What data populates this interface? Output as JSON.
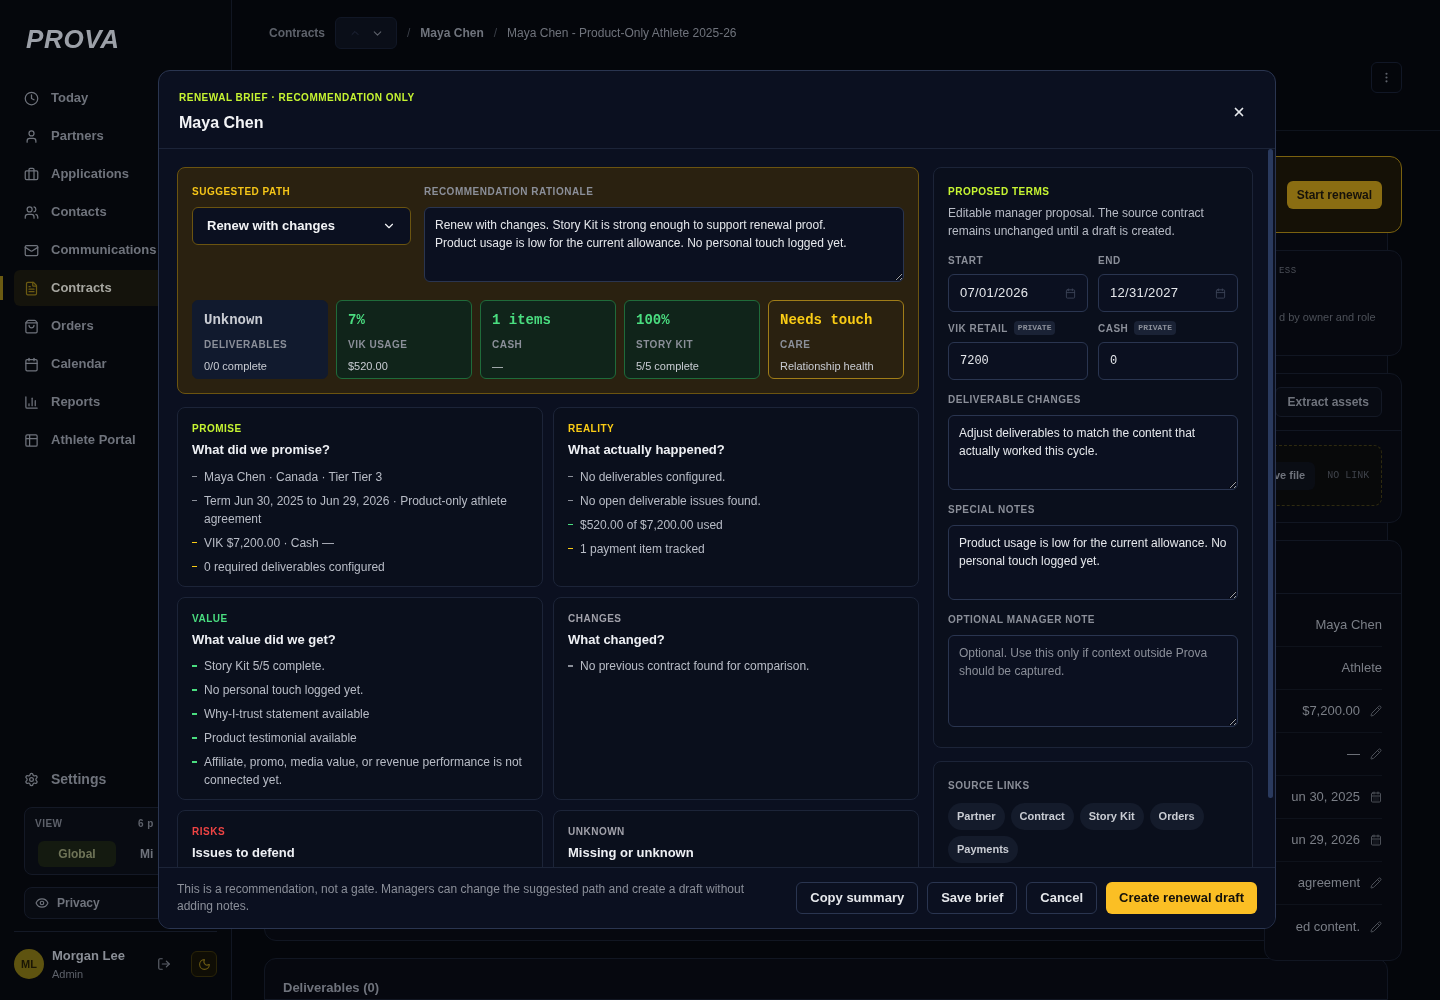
{
  "sidebar": {
    "logo": "PROVA",
    "nav": [
      {
        "label": "Today",
        "selected": false
      },
      {
        "label": "Partners",
        "selected": false
      },
      {
        "label": "Applications",
        "selected": false
      },
      {
        "label": "Contacts",
        "selected": false
      },
      {
        "label": "Communications",
        "selected": false
      },
      {
        "label": "Contracts",
        "selected": true
      },
      {
        "label": "Orders",
        "selected": false
      },
      {
        "label": "Calendar",
        "selected": false
      },
      {
        "label": "Reports",
        "selected": false
      },
      {
        "label": "Athlete Portal",
        "selected": false
      }
    ],
    "settings": "Settings",
    "view": {
      "label": "VIEW",
      "count": "6 p",
      "options": [
        {
          "label": "Global",
          "selected": true
        },
        {
          "label": "Mi",
          "selected": false
        }
      ]
    },
    "privacy": "Privacy",
    "user": {
      "initials": "ML",
      "name": "Morgan Lee",
      "role": "Admin"
    }
  },
  "header": {
    "breadcrumb": [
      {
        "label": "Contracts",
        "kind": "link"
      },
      {
        "label": "/",
        "kind": "separator"
      },
      {
        "label": "Maya Chen",
        "kind": "link"
      },
      {
        "label": "/",
        "kind": "separator"
      },
      {
        "label": "Maya Chen - Product-Only Athlete 2025-26",
        "kind": "current"
      }
    ]
  },
  "side_panel": {
    "start_button": "Start renewal",
    "access_label": "ESS",
    "access_text": "d by owner and role",
    "extract_button": "Extract assets",
    "file_button": "ve file",
    "link_status": "NO LINK",
    "rows": [
      {
        "value": "Maya Chen",
        "kind": "plain"
      },
      {
        "value": "Athlete",
        "kind": "plain"
      },
      {
        "value": "$7,200.00",
        "kind": "editable"
      },
      {
        "value": "—",
        "kind": "editable"
      },
      {
        "value": "un 30, 2025",
        "kind": "date"
      },
      {
        "value": "un 29, 2026",
        "kind": "date"
      },
      {
        "value": "agreement",
        "kind": "editable"
      },
      {
        "value": "ed content.",
        "kind": "editable"
      }
    ]
  },
  "deliverables_title": "Deliverables (0)",
  "modal": {
    "eyebrow": "RENEWAL BRIEF · RECOMMENDATION ONLY",
    "title": "Maya Chen",
    "suggested_path": {
      "label": "SUGGESTED PATH",
      "value": "Renew with changes"
    },
    "rationale": {
      "label": "RECOMMENDATION RATIONALE",
      "value": "Renew with changes. Story Kit is strong enough to support renewal proof.\nProduct usage is low for the current allowance. No personal touch logged yet."
    },
    "metrics": [
      {
        "value": "Unknown",
        "label": "DELIVERABLES",
        "detail": "0/0 complete",
        "kind": "neutral"
      },
      {
        "value": "7%",
        "label": "VIK USAGE",
        "detail": "$520.00",
        "kind": "good"
      },
      {
        "value": "1 items",
        "label": "CASH",
        "detail": "—",
        "kind": "good"
      },
      {
        "value": "100%",
        "label": "STORY KIT",
        "detail": "5/5 complete",
        "kind": "good"
      },
      {
        "value": "Needs touch",
        "label": "CARE",
        "detail": "Relationship health",
        "kind": "warn"
      }
    ],
    "sections": [
      {
        "eyebrow": "PROMISE",
        "color": "#c6f432",
        "title": "What did we promise?",
        "items": [
          {
            "text": "Maya Chen · Canada · Tier Tier 3",
            "color": "#8b8f99"
          },
          {
            "text": "Term Jun 30, 2025 to Jun 29, 2026 · Product-only athlete agreement",
            "color": "#8b8f99"
          },
          {
            "text": "VIK $7,200.00 · Cash —",
            "color": "#facc15"
          },
          {
            "text": "0 required deliverables configured",
            "color": "#facc15"
          }
        ]
      },
      {
        "eyebrow": "REALITY",
        "color": "#facc15",
        "title": "What actually happened?",
        "items": [
          {
            "text": "No deliverables configured.",
            "color": "#8b8f99"
          },
          {
            "text": "No open deliverable issues found.",
            "color": "#8b8f99"
          },
          {
            "text": "$520.00 of $7,200.00 used",
            "color": "#4ade80"
          },
          {
            "text": "1 payment item tracked",
            "color": "#facc15"
          }
        ]
      },
      {
        "eyebrow": "VALUE",
        "color": "#4ade80",
        "title": "What value did we get?",
        "items": [
          {
            "text": "Story Kit 5/5 complete.",
            "color": "#4ade80"
          },
          {
            "text": "No personal touch logged yet.",
            "color": "#4ade80"
          },
          {
            "text": "Why-I-trust statement available",
            "color": "#4ade80"
          },
          {
            "text": "Product testimonial available",
            "color": "#4ade80"
          },
          {
            "text": "Affiliate, promo, media value, or revenue performance is not connected yet.",
            "color": "#4ade80"
          }
        ]
      },
      {
        "eyebrow": "CHANGES",
        "color": "#a1a1aa",
        "title": "What changed?",
        "items": [
          {
            "text": "No previous contract found for comparison.",
            "color": "#8b8f99"
          }
        ]
      },
      {
        "eyebrow": "RISKS",
        "color": "#ef4444",
        "title": "Issues to defend"
      },
      {
        "eyebrow": "UNKNOWN",
        "color": "#a1a1aa",
        "title": "Missing or unknown"
      }
    ],
    "terms": {
      "label": "PROPOSED TERMS",
      "description": "Editable manager proposal. The source contract remains unchanged until a draft is created.",
      "fields": [
        {
          "label": "START",
          "value": "07/01/2026",
          "kind": "date"
        },
        {
          "label": "END",
          "value": "12/31/2027",
          "kind": "date"
        },
        {
          "label": "VIK RETAIL",
          "badge": "PRIVATE",
          "value": "7200",
          "kind": "number"
        },
        {
          "label": "CASH",
          "badge": "PRIVATE",
          "value": "0",
          "kind": "number"
        }
      ],
      "notes": [
        {
          "label": "DELIVERABLE CHANGES",
          "value": "Adjust deliverables to match the content that actually worked this cycle."
        },
        {
          "label": "SPECIAL NOTES",
          "value": "Product usage is low for the current allowance. No personal touch logged yet."
        },
        {
          "label": "OPTIONAL MANAGER NOTE",
          "placeholder": "Optional. Use this only if context outside Prova should be captured."
        }
      ]
    },
    "source_links": {
      "label": "SOURCE LINKS",
      "links": [
        "Partner",
        "Contract",
        "Story Kit",
        "Orders",
        "Payments"
      ]
    },
    "footer_note": "This is a recommendation, not a gate. Managers can change the suggested path and create a draft without adding notes.",
    "buttons": [
      {
        "label": "Copy summary",
        "kind": "secondary"
      },
      {
        "label": "Save brief",
        "kind": "secondary"
      },
      {
        "label": "Cancel",
        "kind": "secondary"
      },
      {
        "label": "Create renewal draft",
        "kind": "primary"
      }
    ]
  }
}
